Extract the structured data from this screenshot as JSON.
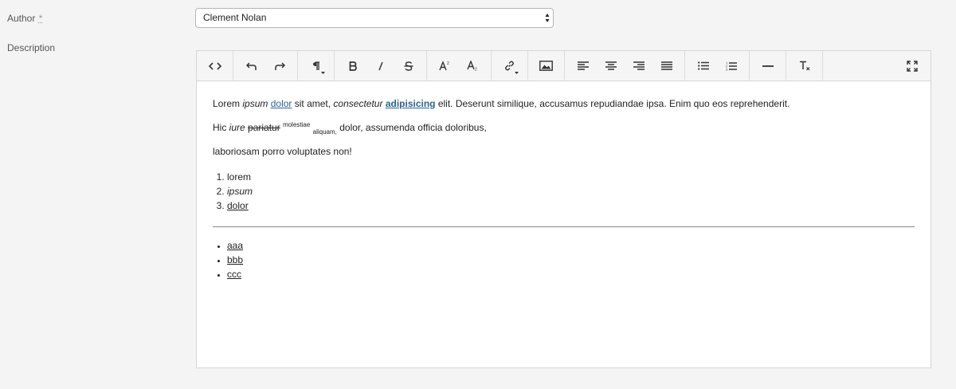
{
  "form": {
    "author_label": "Author",
    "author_required_mark": "*",
    "author_value": "Clement Nolan",
    "description_label": "Description"
  },
  "toolbar": {
    "icons": [
      "source-code-icon",
      "undo-icon",
      "redo-icon",
      "paragraph-format-icon",
      "bold-icon",
      "italic-icon",
      "strikethrough-icon",
      "superscript-icon",
      "subscript-icon",
      "link-icon",
      "image-icon",
      "align-left-icon",
      "align-center-icon",
      "align-right-icon",
      "align-justify-icon",
      "bullet-list-icon",
      "numbered-list-icon",
      "horizontal-rule-icon",
      "clear-formatting-icon",
      "fullscreen-icon"
    ]
  },
  "content": {
    "p1": {
      "t1": "Lorem ",
      "t2_italic": "ipsum",
      "t3": " ",
      "t4_link": "dolor",
      "t5": " sit amet, ",
      "t6_italic": "consectetur",
      "t7": " ",
      "t8_link_bold": "adipisicing",
      "t9": " elit. Deserunt similique, accusamus repudiandae ipsa. Enim quo eos reprehenderit."
    },
    "p2": {
      "t1": "Hic ",
      "t2_italic": "iure",
      "t3": " ",
      "t4_strike": "pariatur",
      "t5": " ",
      "t6_sup": "molestiae",
      "t7": " ",
      "t8_sub": "aliquam,",
      "t9": " dolor, assumenda officia doloribus,"
    },
    "p3": "laboriosam porro voluptates non!",
    "ordered_list": [
      "lorem",
      "ipsum",
      "dolor"
    ],
    "bullet_list": [
      "aaa",
      "bbb",
      "ccc"
    ]
  }
}
